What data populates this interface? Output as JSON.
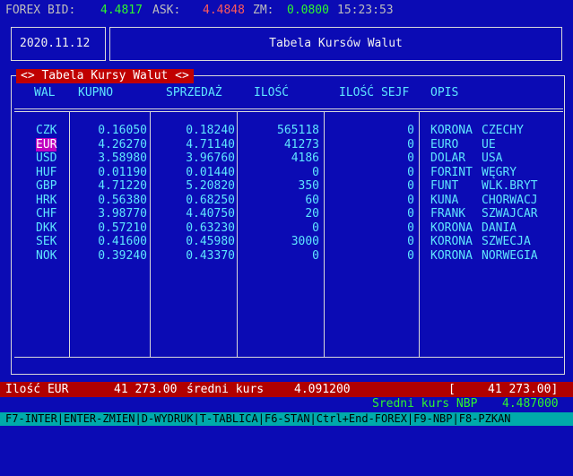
{
  "topbar": {
    "bid_label": "FOREX BID:",
    "bid_value": "4.4817",
    "ask_label": "ASK:",
    "ask_value": "4.4848",
    "zm_label": "ZM:",
    "zm_value": "0.0800",
    "time": "15:23:53"
  },
  "header": {
    "date": "2020.11.12",
    "title": "Tabela Kursów Walut"
  },
  "panel": {
    "title": "<> Tabela Kursy Walut <>",
    "columns": [
      "WAL",
      "KUPNO",
      "SPRZEDAŻ",
      "ILOŚĆ",
      "ILOŚĆ SEJF",
      "OPIS"
    ]
  },
  "rows": [
    {
      "wal": "CZK",
      "kupno": "0.16050",
      "sprzedaz": "0.18240",
      "ilosc": "565118",
      "sejf": "0",
      "opis1": "KORONA",
      "opis2": "CZECHY"
    },
    {
      "wal": "EUR",
      "kupno": "4.26270",
      "sprzedaz": "4.71140",
      "ilosc": "41273",
      "sejf": "0",
      "opis1": "EURO",
      "opis2": "UE"
    },
    {
      "wal": "USD",
      "kupno": "3.58980",
      "sprzedaz": "3.96760",
      "ilosc": "4186",
      "sejf": "0",
      "opis1": "DOLAR",
      "opis2": "USA"
    },
    {
      "wal": "HUF",
      "kupno": "0.01190",
      "sprzedaz": "0.01440",
      "ilosc": "0",
      "sejf": "0",
      "opis1": "FORINT",
      "opis2": "WĘGRY"
    },
    {
      "wal": "GBP",
      "kupno": "4.71220",
      "sprzedaz": "5.20820",
      "ilosc": "350",
      "sejf": "0",
      "opis1": "FUNT",
      "opis2": "WLK.BRYT"
    },
    {
      "wal": "HRK",
      "kupno": "0.56380",
      "sprzedaz": "0.68250",
      "ilosc": "60",
      "sejf": "0",
      "opis1": "KUNA",
      "opis2": "CHORWACJ"
    },
    {
      "wal": "CHF",
      "kupno": "3.98770",
      "sprzedaz": "4.40750",
      "ilosc": "20",
      "sejf": "0",
      "opis1": "FRANK",
      "opis2": "SZWAJCAR"
    },
    {
      "wal": "DKK",
      "kupno": "0.57210",
      "sprzedaz": "0.63230",
      "ilosc": "0",
      "sejf": "0",
      "opis1": "KORONA",
      "opis2": "DANIA"
    },
    {
      "wal": "SEK",
      "kupno": "0.41600",
      "sprzedaz": "0.45980",
      "ilosc": "3000",
      "sejf": "0",
      "opis1": "KORONA",
      "opis2": "SZWECJA"
    },
    {
      "wal": "NOK",
      "kupno": "0.39240",
      "sprzedaz": "0.43370",
      "ilosc": "0",
      "sejf": "0",
      "opis1": "KORONA",
      "opis2": "NORWEGIA"
    }
  ],
  "status": {
    "left": "Ilość EUR",
    "amount": "41 273.00",
    "avg_label": "średni kurs",
    "avg_value": "4.091200",
    "bracket_open": "[",
    "bracket_value": "41 273.00]"
  },
  "nbp": {
    "label": "Sredni kurs NBP",
    "value": "4.487000"
  },
  "fkeys": "F7-INTER|ENTER-ZMIEN|D-WYDRUK|T-TABLICA|F6-STAN|Ctrl+End-FOREX|F9-NBP|F8-PZKAN",
  "colors": {
    "background": "#0b0bb4",
    "status_bar": "#b00000",
    "selected_row": "#c000c0",
    "fkeys_bar": "#00aaaa"
  }
}
